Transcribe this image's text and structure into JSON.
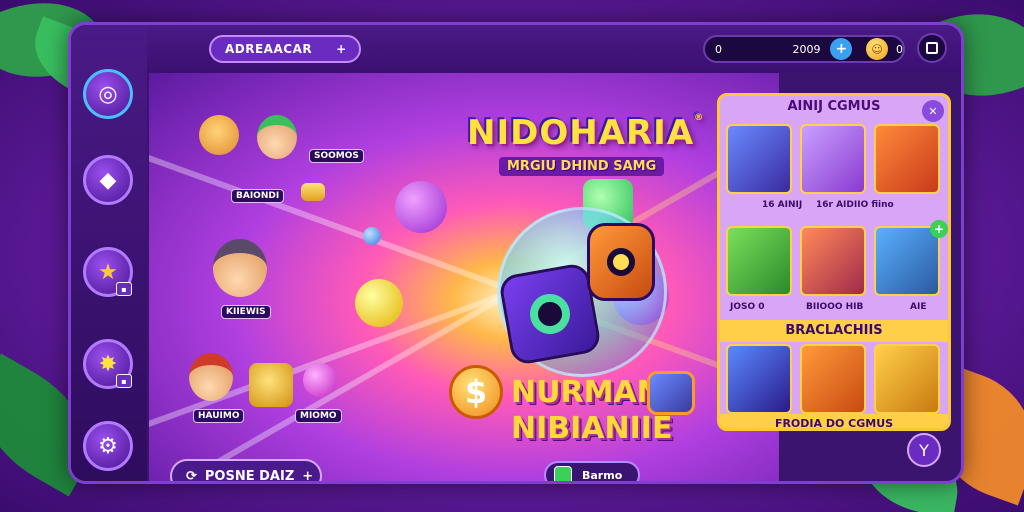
{
  "header": {
    "title_button": "ADREAACAR",
    "title_plus": "+",
    "currency_left": "0",
    "currency_amount": "2009",
    "add_currency": "+",
    "coin_count": "0"
  },
  "game": {
    "title": "NIDOHARIA",
    "trademark": "®",
    "subtitle": "MRGIU DHIND SAMG",
    "slogan_line1": "NURMAN",
    "slogan_line2": "NIBIANIIE",
    "dollar_symbol": "$"
  },
  "characters": [
    {
      "label": "SOOMOS"
    },
    {
      "label": "BAIONDI"
    },
    {
      "label": "KIIEWIS"
    },
    {
      "label": "HAUIMO"
    },
    {
      "label": "MIOMO"
    }
  ],
  "buttons": {
    "play": "POSNE DAIZ",
    "play_plus": "+",
    "mid": "Barmo"
  },
  "panel": {
    "title": "AINIJ CGMUS",
    "row1_labels": [
      "16 AINIJ",
      "16r AIDIIO fiino"
    ],
    "row2_labels": [
      "JOSO 0",
      "BIIOOO HIB",
      "AIE"
    ],
    "section_title": "BRACLACHIIS",
    "footer": "FRODIA DO CGMUS"
  },
  "colors": {
    "accent": "#ffcf4a",
    "frame": "#7e3fd0",
    "panel_bg": "#d9a5f5",
    "title_yellow": "#ffe23d"
  },
  "icons": [
    "plus-icon",
    "coin-icon",
    "menu-icon",
    "dice-icon",
    "gem-icon",
    "star-icon",
    "gear-icon"
  ]
}
